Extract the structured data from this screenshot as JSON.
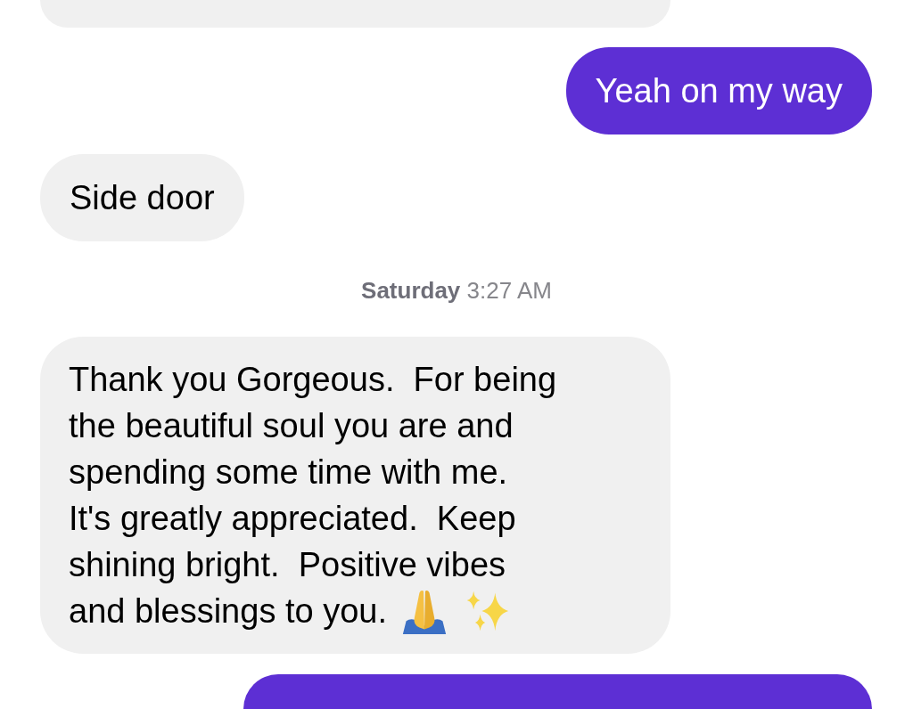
{
  "messages": [
    {
      "kind": "received",
      "cut_top": true
    },
    {
      "kind": "sent",
      "text": "Yeah on my way"
    },
    {
      "kind": "received",
      "text": "Side door"
    },
    {
      "kind": "timestamp",
      "text": "**Saturday** 3:27 AM"
    },
    {
      "kind": "received",
      "lines": [
        "Thank you Gorgeous.  For being",
        "the beautiful soul you are and",
        "spending some time with me.",
        "It's greatly appreciated.  Keep",
        "shining bright.  Positive vibes",
        "and blessings to you."
      ],
      "emoji": true
    },
    {
      "kind": "sent",
      "cut_bottom": true
    }
  ]
}
